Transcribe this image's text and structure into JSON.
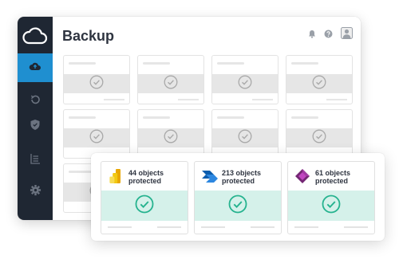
{
  "app": {
    "title": "Backup",
    "accent": "#1f8fd0",
    "sidebar_bg": "#1f2733"
  },
  "sidebar": {
    "logo_icon": "cloud-icon",
    "items": [
      {
        "icon": "cloud-upload-icon",
        "active": true
      },
      {
        "icon": "restore-icon",
        "active": false
      },
      {
        "icon": "shield-icon",
        "active": false
      },
      {
        "icon": "list-icon",
        "active": false
      },
      {
        "icon": "gear-icon",
        "active": false
      }
    ]
  },
  "header_icons": [
    "bell-icon",
    "help-icon",
    "user-avatar-icon"
  ],
  "backup_cards": [
    {
      "text": "44 objects protected",
      "product_icon": "power-bi-icon",
      "status": "protected"
    },
    {
      "text": "213 objects protected",
      "product_icon": "power-automate-icon",
      "status": "protected"
    },
    {
      "text": "61 objects protected",
      "product_icon": "power-apps-icon",
      "status": "protected"
    }
  ],
  "colors": {
    "protected_bg": "#d5f1ea",
    "protected_check": "#26b38f"
  }
}
